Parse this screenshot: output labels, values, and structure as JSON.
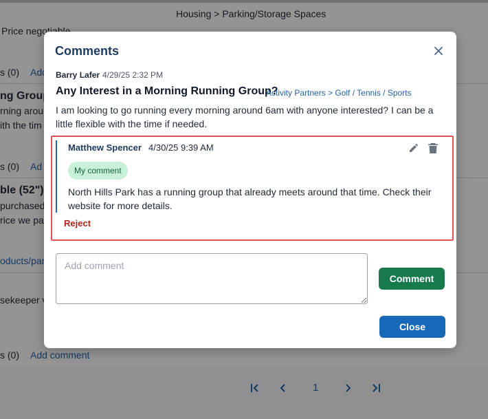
{
  "background": {
    "breadcrumb": "Housing > Parking/Storage Spaces",
    "price_note": "Price negotiable",
    "rows": [
      {
        "count": "s (0)",
        "link": "Add"
      },
      {
        "count": "s (0)",
        "link": "Ad"
      },
      {
        "count": "s (0)",
        "link": "Add comment"
      }
    ],
    "fragments": {
      "group_title": "ng Group",
      "line_a": "rning aroun",
      "line_b": "ith the tim",
      "item_title": "ble (52\")",
      "line_c": "purchased",
      "line_d": "rice we paid",
      "link_products": "oducts/panc",
      "line_e": "sekeeper v"
    },
    "pagination": {
      "current_page": "1"
    }
  },
  "modal": {
    "title": "Comments",
    "post": {
      "author": "Barry Lafer",
      "date": "4/29/25 2:32 PM",
      "title": "Any Interest in a Morning Running Group?",
      "category": "Activity Partners > Golf / Tennis / Sports",
      "body": "I am looking to go running every morning around 6am with anyone interested? I can be a little flexible with the time if needed."
    },
    "comment": {
      "author": "Matthew Spencer",
      "date": "4/30/25 9:39 AM",
      "badge": "My comment",
      "body": "North Hills Park has a running group that already meets around that time. Check their website for more details.",
      "reject_label": "Reject"
    },
    "input": {
      "placeholder": "Add comment",
      "value": ""
    },
    "comment_button": "Comment",
    "close_button": "Close"
  },
  "icons": {
    "close": "close-icon",
    "edit": "pencil-icon",
    "delete": "trash-icon",
    "first": "first-page-icon",
    "prev": "chevron-left-icon",
    "next": "chevron-right-icon",
    "last": "last-page-icon"
  },
  "colors": {
    "primary_blue": "#1769b8",
    "comment_green": "#177a4c",
    "reject_red": "#b42318",
    "highlight_red": "#e05252",
    "badge_bg": "#c9f0da"
  }
}
